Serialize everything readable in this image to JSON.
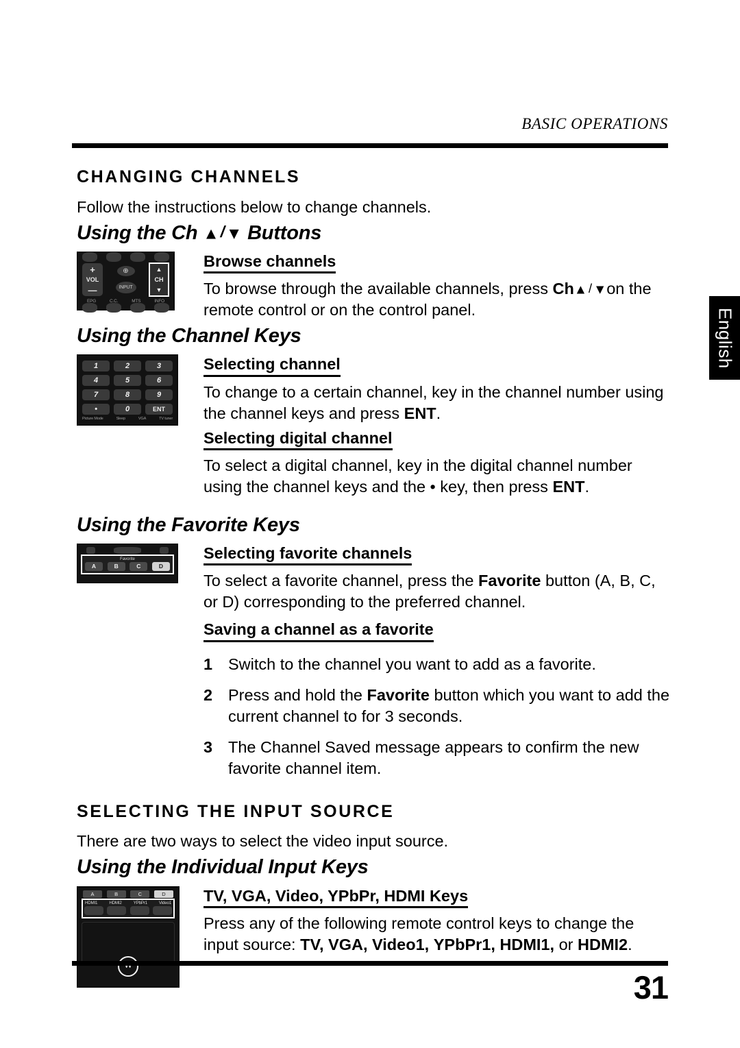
{
  "header": {
    "running_head": "BASIC OPERATIONS",
    "page_number": "31",
    "language_tab": "English"
  },
  "sections": {
    "changing_channels": {
      "heading": "CHANGING CHANNELS",
      "intro": "Follow the instructions below to change channels.",
      "ch_buttons": {
        "heading_pre": "Using the Ch",
        "arrow_up": "▲",
        "slash": "/",
        "arrow_down": "▼",
        "heading_post": "Buttons",
        "minor_head": "Browse channels",
        "body_1": "To browse through the available channels, press",
        "body_ch": "Ch",
        "body_2": "on",
        "body_3": "the remote control or on the control panel."
      },
      "channel_keys": {
        "heading": "Using the Channel Keys",
        "minor_head_1": "Selecting channel",
        "body_1a": "To change to a certain channel, key in the channel number using the channel keys and press ",
        "body_1b": "ENT",
        "body_1c": ".",
        "minor_head_2": "Selecting digital channel",
        "body_2a": "To select a digital channel, key in the digital channel number using the channel keys and the • key, then press ",
        "body_2b": "ENT",
        "body_2c": "."
      },
      "favorite_keys": {
        "heading": "Using the Favorite Keys",
        "minor_head_1": "Selecting favorite channels",
        "body_1a": "To select a favorite channel, press the ",
        "body_1b": "Favorite",
        "body_1c": " button (A, B, C, or D) corresponding to the preferred channel.",
        "minor_head_2": "Saving a channel as a favorite",
        "steps": [
          {
            "num": "1",
            "text_a": "Switch to the channel you want to add as a favorite.",
            "bold": "",
            "text_b": ""
          },
          {
            "num": "2",
            "text_a": "Press and hold the ",
            "bold": "Favorite",
            "text_b": " button which you want to add the current channel to for 3 seconds."
          },
          {
            "num": "3",
            "text_a": "The Channel Saved message appears to confirm the new favorite channel item.",
            "bold": "",
            "text_b": ""
          }
        ]
      }
    },
    "input_source": {
      "heading": "SELECTING THE INPUT SOURCE",
      "intro": "There are two ways to select the video input source.",
      "individual_keys": {
        "heading": "Using the Individual Input Keys",
        "minor_head": "TV, VGA, Video, YPbPr, HDMI Keys",
        "body_a": "Press any of the following remote control keys to change the input source: ",
        "body_tv": "TV,",
        "body_vga": "VGA,",
        "body_video1": "Video1,",
        "body_ypbpr1": "YPbPr1,",
        "body_hdmi1": "HDMI1,",
        "body_or": " or ",
        "body_hdmi2": "HDMI2",
        "body_end": "."
      }
    }
  },
  "figures": {
    "control_panel": {
      "vol_label": "VOL",
      "vol_plus": "+",
      "vol_minus": "—",
      "input_label": "INPUT",
      "aspect_icon": "⊕",
      "ch_label": "CH",
      "ch_up": "▲",
      "ch_down": "▼",
      "bottom_labels": [
        "EPG",
        "C.C.",
        "MTS",
        "INFO"
      ]
    },
    "keypad": {
      "keys": [
        "1",
        "2",
        "3",
        "4",
        "5",
        "6",
        "7",
        "8",
        "9",
        "•",
        "0",
        "ENT"
      ],
      "bottom_labels": [
        "Picture Mode",
        "Sleep",
        "VGA",
        "TV tuner"
      ]
    },
    "favorite_panel": {
      "caption": "Favorite",
      "buttons": [
        "A",
        "B",
        "C",
        "D"
      ],
      "highlighted": "D"
    },
    "input_panel": {
      "abcd": [
        "A",
        "B",
        "C",
        "D"
      ],
      "highlighted": "D",
      "key_labels": [
        "HDMI1",
        "HDMI2",
        "YPbPr1",
        "Video1"
      ],
      "brand_mark": "W"
    }
  },
  "colors": {
    "page_background": "#ffffff",
    "ink": "#000000",
    "remote_body": "#131313",
    "remote_key": "#3a3a3a",
    "highlight_key": "#d3d3d3"
  }
}
